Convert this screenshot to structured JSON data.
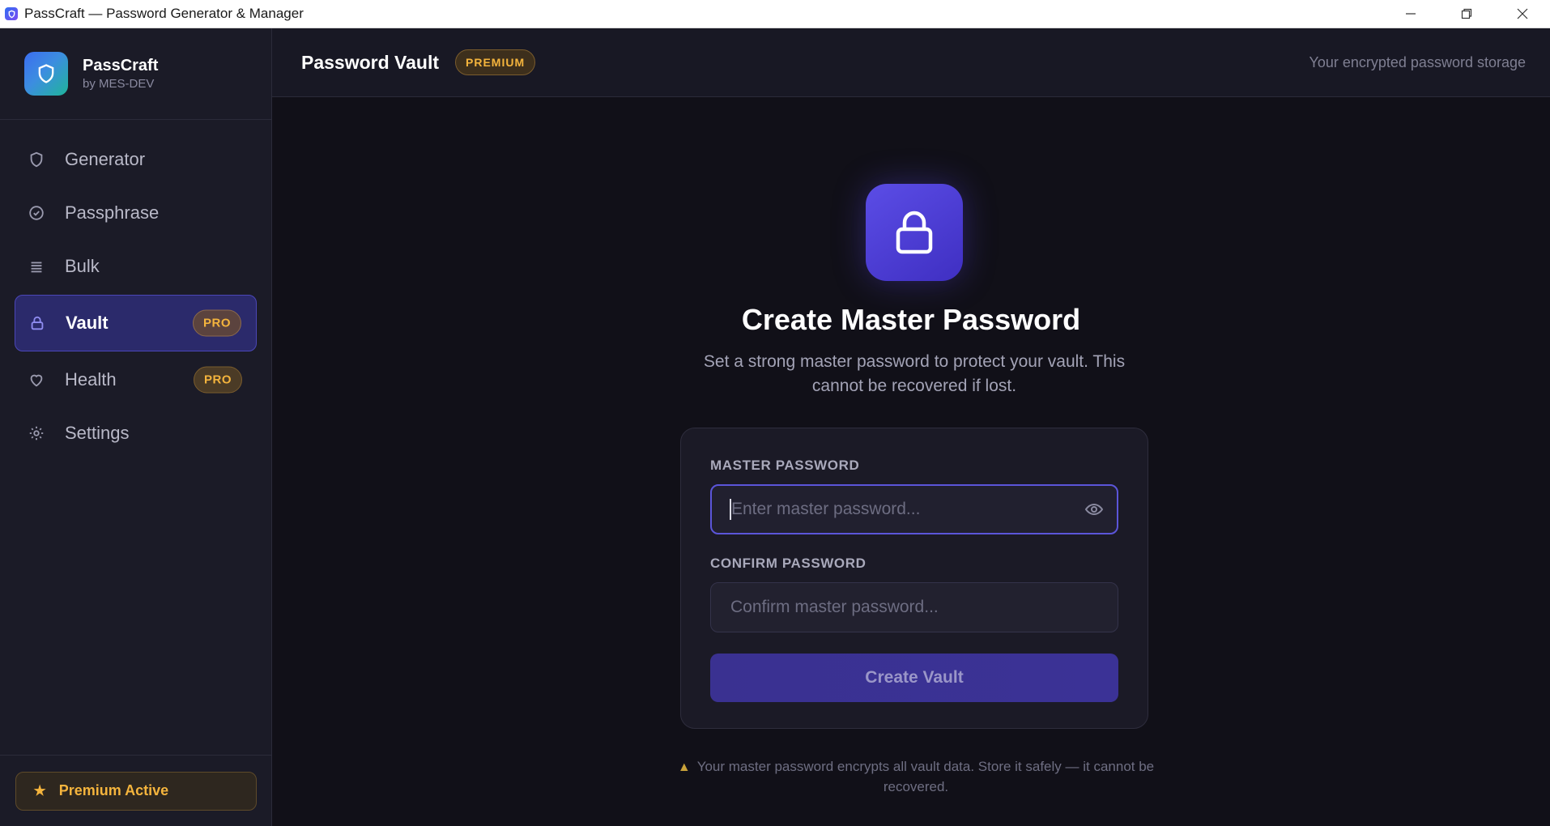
{
  "window": {
    "title": "PassCraft — Password Generator & Manager",
    "controls": [
      "minimize-icon",
      "restore-icon",
      "close-icon"
    ]
  },
  "brand": {
    "name": "PassCraft",
    "byline": "by MES-DEV",
    "logo_icon": "shield-icon"
  },
  "sidebar": {
    "items": [
      {
        "label": "Generator",
        "icon": "shield-icon"
      },
      {
        "label": "Passphrase",
        "icon": "check-circle-icon"
      },
      {
        "label": "Bulk",
        "icon": "list-icon"
      },
      {
        "label": "Vault",
        "icon": "lock-icon",
        "badge": "PRO",
        "active": true
      },
      {
        "label": "Health",
        "icon": "heart-icon",
        "badge": "PRO"
      },
      {
        "label": "Settings",
        "icon": "gear-icon"
      }
    ],
    "footer": {
      "label": "Premium Active",
      "icon": "star-icon"
    }
  },
  "header": {
    "title": "Password Vault",
    "badge": "PREMIUM",
    "subtitle": "Your encrypted password storage"
  },
  "vault_setup": {
    "icon": "lock-icon",
    "title": "Create Master Password",
    "description": "Set a strong master password to protect your vault. This cannot be recovered if lost.",
    "master_label": "MASTER PASSWORD",
    "master_placeholder": "Enter master password...",
    "master_value": "",
    "confirm_label": "CONFIRM PASSWORD",
    "confirm_placeholder": "Confirm master password...",
    "confirm_value": "",
    "button_label": "Create Vault",
    "warning": "Your master password encrypts all vault data. Store it safely — it cannot be recovered."
  },
  "colors": {
    "accent": "#5b55d9",
    "premium": "#f4b43d",
    "sidebar_bg": "#1b1b27",
    "main_bg": "#111018"
  }
}
